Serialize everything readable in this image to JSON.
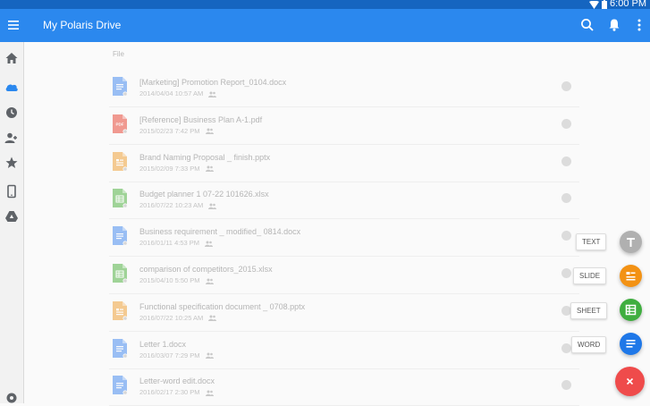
{
  "status_bar": {
    "time": "6:00 PM"
  },
  "app_bar": {
    "title": "My Polaris Drive"
  },
  "sidebar": {
    "items": [
      "home-icon",
      "polaris-drive-icon",
      "recent-icon",
      "shared-icon",
      "starred-icon",
      "device-icon",
      "google-drive-icon",
      "settings-icon"
    ]
  },
  "file_list": {
    "header": "File",
    "files": [
      {
        "name": "[Marketing] Promotion Report_0104.docx",
        "date": "2014/04/04 10:57 AM",
        "type": "word"
      },
      {
        "name": "[Reference] Business Plan A-1.pdf",
        "date": "2015/02/23 7:42 PM",
        "type": "pdf"
      },
      {
        "name": "Brand Naming Proposal _ finish.pptx",
        "date": "2015/02/09 7:33 PM",
        "type": "slide"
      },
      {
        "name": "Budget planner 1 07-22 101626.xlsx",
        "date": "2016/07/22 10:23 AM",
        "type": "sheet"
      },
      {
        "name": "Business requirement _ modified_ 0814.docx",
        "date": "2016/01/11 4:53 PM",
        "type": "word"
      },
      {
        "name": "comparison of competitors_2015.xlsx",
        "date": "2015/04/10 5:50 PM",
        "type": "sheet"
      },
      {
        "name": "Functional specification document _ 0708.pptx",
        "date": "2016/07/22 10:25 AM",
        "type": "slide"
      },
      {
        "name": "Letter 1.docx",
        "date": "2016/03/07 7:29 PM",
        "type": "word"
      },
      {
        "name": "Letter-word edit.docx",
        "date": "2016/02/17 2:30 PM",
        "type": "word"
      }
    ]
  },
  "fab_menu": {
    "text_label": "TEXT",
    "slide_label": "SLIDE",
    "sheet_label": "SHEET",
    "word_label": "WORD"
  },
  "colors": {
    "app_bar": "#2b88ee",
    "status_bar": "#1565c0",
    "word": "#4a8ef0",
    "pdf": "#e84a3b",
    "slide": "#f0a33c",
    "sheet": "#56b448",
    "text_fab": "#b0b0b0",
    "slide_fab": "#f39214",
    "sheet_fab": "#3fae3f",
    "word_fab": "#1f78e8",
    "close_fab": "#ef4b4b"
  }
}
